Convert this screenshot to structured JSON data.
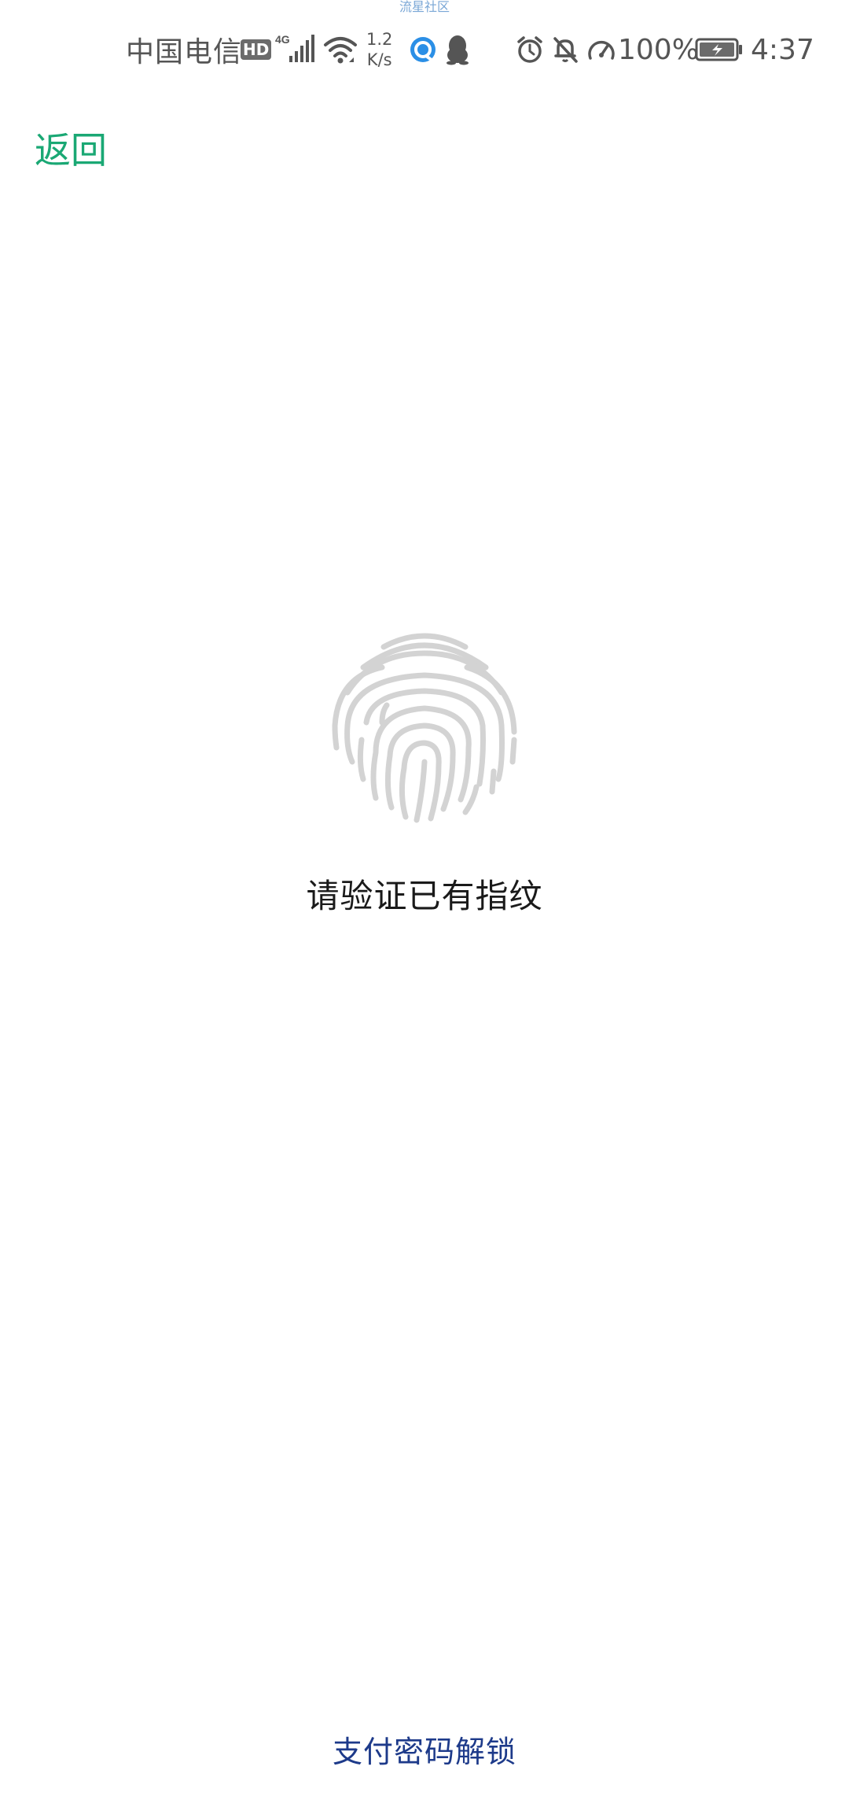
{
  "watermark": "流星社区",
  "status_bar": {
    "carrier": "中国电信",
    "hd_badge": "HD",
    "network_type": "4G",
    "net_speed_value": "1.2",
    "net_speed_unit": "K/s",
    "icons": [
      "hd-icon",
      "signal-icon",
      "wifi-icon",
      "browser-icon",
      "qq-icon",
      "alarm-icon",
      "bell-muted-icon",
      "speed-icon",
      "battery-icon"
    ],
    "battery_percent": "100%",
    "time": "4:37"
  },
  "header": {
    "back_label": "返回"
  },
  "main": {
    "fingerprint_icon": "fingerprint-icon",
    "prompt": "请验证已有指纹"
  },
  "footer": {
    "pay_unlock_label": "支付密码解锁"
  },
  "colors": {
    "accent_green": "#1aa874",
    "link_blue": "#1d3a8a",
    "fingerprint_gray": "#d3d3d3",
    "status_text": "#555555"
  }
}
